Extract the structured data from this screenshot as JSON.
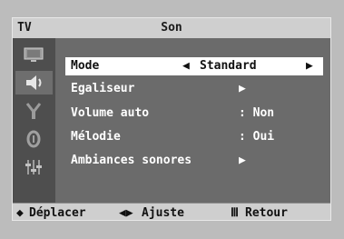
{
  "header": {
    "tv_label": "TV",
    "title": "Son"
  },
  "sidebar": {
    "icons": [
      "picture-icon",
      "sound-icon",
      "channel-icon",
      "setup-icon",
      "input-icon"
    ],
    "active": "sound-icon"
  },
  "menu": {
    "items": [
      {
        "label": "Mode",
        "value": "Standard",
        "arrow_left": "◀",
        "arrow_right": "▶"
      },
      {
        "label": "Egaliseur",
        "arrow": "▶"
      },
      {
        "label": "Volume auto",
        "value": ": Non"
      },
      {
        "label": "Mélodie",
        "value": ": Oui"
      },
      {
        "label": "Ambiances sonores",
        "arrow": "▶"
      }
    ]
  },
  "footer": {
    "move_symbol": "◆",
    "move": "Déplacer",
    "adjust_symbol": "◀▶",
    "adjust": "Ajuste",
    "return_symbol": "Ⅲ",
    "return": "Retour"
  }
}
